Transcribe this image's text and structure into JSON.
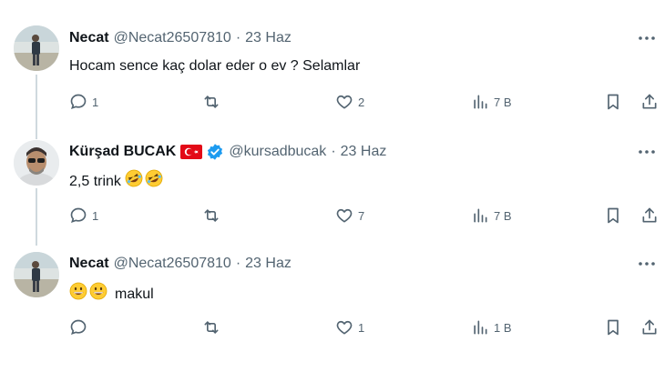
{
  "tweets": [
    {
      "name": "Necat",
      "handle": "@Necat26507810",
      "separator": "·",
      "date": "23 Haz",
      "text": "Hocam sence kaç dolar eder o ev ? Selamlar",
      "emojis_before": [],
      "emojis_after": [],
      "replies": "1",
      "retweets": "",
      "likes": "2",
      "views": "7 B",
      "has_flag": false,
      "verified": false
    },
    {
      "name": "Kürşad BUCAK",
      "handle": "@kursadbucak",
      "separator": "·",
      "date": "23 Haz",
      "text": "2,5 trink",
      "emojis_before": [],
      "emojis_after": [
        "rolling-laughing-emoji",
        "rolling-laughing-emoji"
      ],
      "replies": "1",
      "retweets": "",
      "likes": "7",
      "views": "7 B",
      "has_flag": true,
      "verified": true
    },
    {
      "name": "Necat",
      "handle": "@Necat26507810",
      "separator": "·",
      "date": "23 Haz",
      "text": "makul",
      "emojis_before": [
        "grinning-face-emoji",
        "grinning-face-emoji"
      ],
      "emojis_after": [],
      "replies": "",
      "retweets": "",
      "likes": "1",
      "views": "1 B",
      "has_flag": false,
      "verified": false
    }
  ],
  "colors": {
    "text_primary": "#0f1419",
    "text_secondary": "#536471",
    "verified_blue": "#1d9bf0",
    "thread_line": "#cfd9de",
    "flag_red": "#e30a17"
  },
  "icons": {
    "reply": "reply-icon",
    "retweet": "retweet-icon",
    "like": "heart-icon",
    "views": "views-icon",
    "bookmark": "bookmark-icon",
    "share": "share-icon",
    "more": "more-icon"
  }
}
